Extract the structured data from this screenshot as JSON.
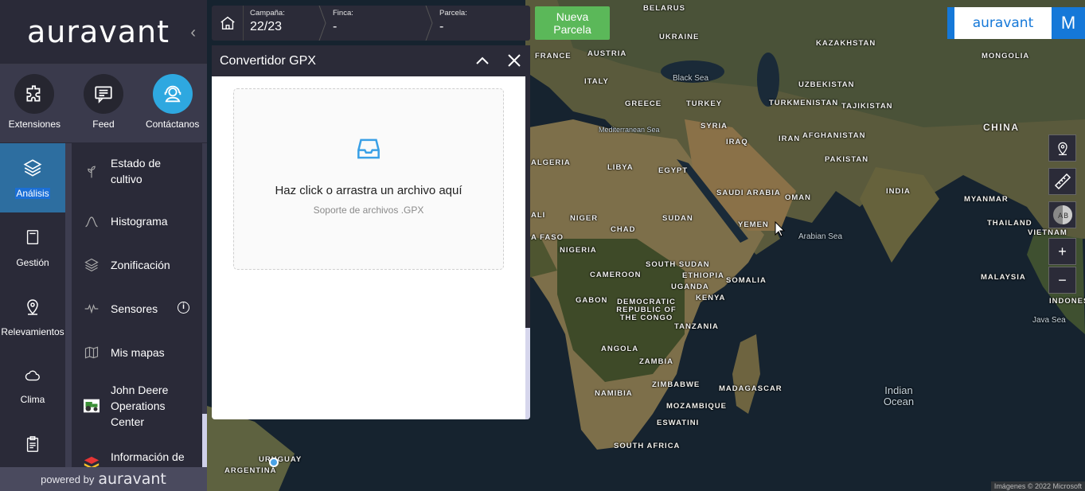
{
  "sidebar": {
    "logo": "auravant",
    "top_icons": [
      {
        "label": "Extensiones",
        "icon": "puzzle-icon"
      },
      {
        "label": "Feed",
        "icon": "feed-icon"
      },
      {
        "label": "Contáctanos",
        "icon": "support-agent-icon"
      }
    ],
    "nav": [
      {
        "label": "Análisis",
        "icon": "layers-icon",
        "active": true
      },
      {
        "label": "Gestión",
        "icon": "notebook-icon"
      },
      {
        "label": "Relevamientos",
        "icon": "location-pin-icon"
      },
      {
        "label": "Clima",
        "icon": "cloud-icon"
      },
      {
        "label": "",
        "icon": "clipboard-icon"
      }
    ],
    "sub_items": [
      {
        "label": "Estado de cultivo",
        "icon": "plant-icon"
      },
      {
        "label": "Histograma",
        "icon": "histogram-icon"
      },
      {
        "label": "Zonificación",
        "icon": "layers-icon"
      },
      {
        "label": "Sensores",
        "icon": "pulse-icon",
        "info": "i"
      },
      {
        "label": "Mis mapas",
        "icon": "map-icon"
      },
      {
        "label": "John Deere Operations Center",
        "icon": "tractor-icon"
      },
      {
        "label": "Información de suelo",
        "icon": "soil-stack-icon"
      }
    ],
    "powered_prefix": "powered by",
    "powered_brand": "auravant"
  },
  "topbar": {
    "campaign_label": "Campaña:",
    "campaign_value": "22/23",
    "farm_label": "Finca:",
    "farm_value": "-",
    "plot_label": "Parcela:",
    "plot_value": "-",
    "new_plot_button": "Nueva Parcela"
  },
  "brand_box": "auravant",
  "user_initial": "M",
  "panel": {
    "title": "Convertidor GPX",
    "drop_text": "Haz click o arrastra un archivo aquí",
    "drop_hint": "Soporte de archivos .GPX"
  },
  "map_controls": [
    {
      "icon": "location-pin-icon"
    },
    {
      "icon": "ruler-icon"
    },
    {
      "icon": "ab-compare-icon"
    },
    {
      "label": "+"
    },
    {
      "label": "−"
    }
  ],
  "map": {
    "labels": [
      "BELARUS",
      "UKRAINE",
      "FRANCE",
      "AUSTRIA",
      "ITALY",
      "GREECE",
      "TURKEY",
      "Black Sea",
      "KAZAKHSTAN",
      "MONGOLIA",
      "UZBEKISTAN",
      "TURKMENISTAN",
      "TAJIKISTAN",
      "CHINA",
      "SYRIA",
      "IRAQ",
      "IRAN",
      "AFGHANISTAN",
      "PAKISTAN",
      "INDIA",
      "Mediterranean Sea",
      "ALGERIA",
      "LIBYA",
      "EGYPT",
      "SAUDI ARABIA",
      "OMAN",
      "YEMEN",
      "MYANMAR",
      "THAILAND",
      "VIETNAM",
      "Arabian Sea",
      "ALI",
      "NIGER",
      "CHAD",
      "SUDAN",
      "A FASO",
      "NIGERIA",
      "SOUTH SUDAN",
      "CAMEROON",
      "ETHIOPIA",
      "UGANDA",
      "KENYA",
      "SOMALIA",
      "GABON",
      "DEMOCRATIC REPUBLIC OF THE CONGO",
      "TANZANIA",
      "MALAYSIA",
      "INDONES",
      "Java Sea",
      "ANGOLA",
      "ZAMBIA",
      "ZIMBABWE",
      "NAMIBIA",
      "MADAGASCAR",
      "MOZAMBIQUE",
      "ESWATINI",
      "SOUTH AFRICA",
      "Indian Ocean",
      "URUGUAY",
      "ARGENTINA"
    ],
    "credit": "Imágenes © 2022 Microsoft"
  },
  "colors": {
    "accent": "#2ea8e0",
    "brand_blue": "#1578d8",
    "green": "#5bb859",
    "sidebar": "#2a2a38"
  }
}
